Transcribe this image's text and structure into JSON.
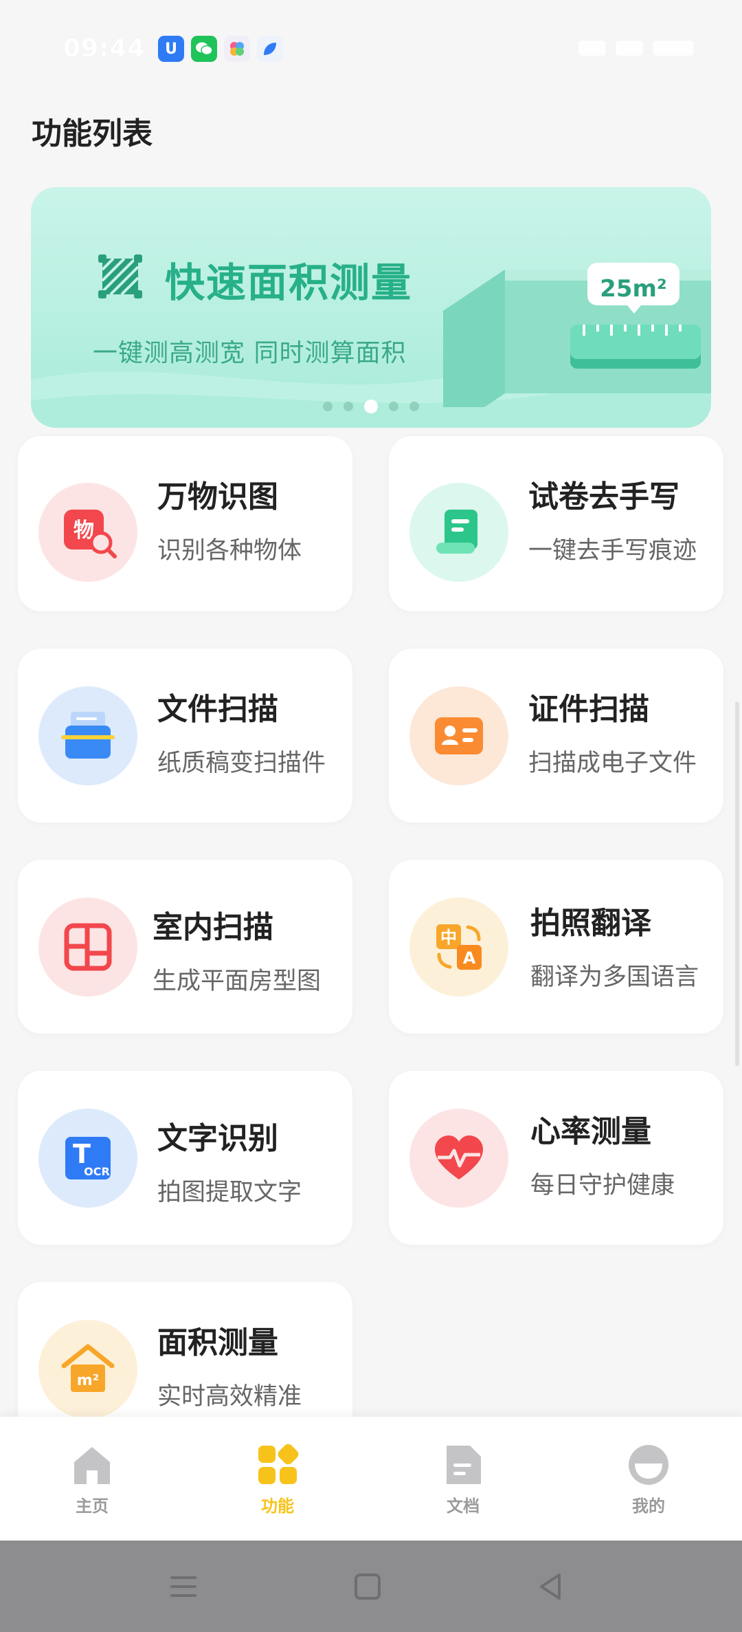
{
  "status_bar": {
    "time": "09:44",
    "apps": [
      {
        "icon": "u-app-icon",
        "color": "#2f7bf6",
        "glyph": "U"
      },
      {
        "icon": "wechat-icon",
        "color": "#1fc35a",
        "glyph": "●"
      },
      {
        "icon": "flower-app-icon",
        "color": "#f1eef7",
        "glyph": "✿"
      },
      {
        "icon": "leaf-app-icon",
        "color": "#eef3fb",
        "glyph": "◆"
      }
    ]
  },
  "page": {
    "title": "功能列表"
  },
  "banner": {
    "title": "快速面积测量",
    "subtitle": "一键测高测宽  同时测算面积",
    "area_tag": "25m²",
    "dots": 5,
    "active_dot": 2
  },
  "features": [
    {
      "title": "万物识图",
      "desc": "识别各种物体",
      "icon": "object-recognition-icon",
      "bg": "#fde4e4"
    },
    {
      "title": "试卷去手写",
      "desc": "一键去手写痕迹",
      "icon": "remove-handwriting-icon",
      "bg": "#dcf7ee"
    },
    {
      "title": "文件扫描",
      "desc": "纸质稿变扫描件",
      "icon": "document-scan-icon",
      "bg": "#dceafc"
    },
    {
      "title": "证件扫描",
      "desc": "扫描成电子文件",
      "icon": "id-card-scan-icon",
      "bg": "#fde7d7"
    },
    {
      "title": "室内扫描",
      "desc": "生成平面房型图",
      "icon": "floor-plan-icon",
      "bg": "#fde4e4"
    },
    {
      "title": "拍照翻译",
      "desc": "翻译为多国语言",
      "icon": "translate-icon",
      "bg": "#fdf0d9"
    },
    {
      "title": "文字识别",
      "desc": "拍图提取文字",
      "icon": "ocr-icon",
      "bg": "#dceafc"
    },
    {
      "title": "心率测量",
      "desc": "每日守护健康",
      "icon": "heart-rate-icon",
      "bg": "#fde4e4"
    },
    {
      "title": "面积测量",
      "desc": "实时高效精准",
      "icon": "area-measure-icon",
      "bg": "#fdf0d9"
    }
  ],
  "tabbar": {
    "tabs": [
      {
        "label": "主页",
        "icon": "home-icon"
      },
      {
        "label": "功能",
        "icon": "apps-icon",
        "active": true
      },
      {
        "label": "文档",
        "icon": "document-icon"
      },
      {
        "label": "我的",
        "icon": "profile-icon"
      }
    ]
  },
  "colors": {
    "accent": "#f7c31b",
    "banner_green": "#27b089",
    "background": "#f6f6f7"
  }
}
